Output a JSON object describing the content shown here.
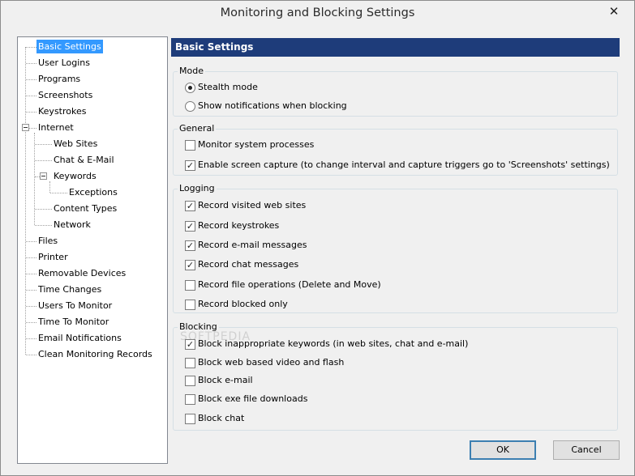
{
  "window": {
    "title": "Monitoring and Blocking Settings",
    "close_glyph": "✕"
  },
  "tree": {
    "items": [
      {
        "label": "Basic Settings"
      },
      {
        "label": "User Logins"
      },
      {
        "label": "Programs"
      },
      {
        "label": "Screenshots"
      },
      {
        "label": "Keystrokes"
      },
      {
        "label": "Internet"
      },
      {
        "label": "Web Sites"
      },
      {
        "label": "Chat & E-Mail"
      },
      {
        "label": "Keywords"
      },
      {
        "label": "Exceptions"
      },
      {
        "label": "Content Types"
      },
      {
        "label": "Network"
      },
      {
        "label": "Files"
      },
      {
        "label": "Printer"
      },
      {
        "label": "Removable Devices"
      },
      {
        "label": "Time Changes"
      },
      {
        "label": "Users To Monitor"
      },
      {
        "label": "Time To Monitor"
      },
      {
        "label": "Email Notifications"
      },
      {
        "label": "Clean Monitoring Records"
      }
    ]
  },
  "panel": {
    "header": "Basic Settings"
  },
  "mode": {
    "title": "Mode",
    "options": [
      {
        "label": "Stealth mode",
        "selected": true
      },
      {
        "label": "Show notifications when blocking",
        "selected": false
      }
    ]
  },
  "general": {
    "title": "General",
    "options": [
      {
        "label": "Monitor system processes",
        "checked": false
      },
      {
        "label": "Enable screen capture (to change  interval and capture triggers go to 'Screenshots' settings)",
        "checked": true
      }
    ]
  },
  "logging": {
    "title": "Logging",
    "options": [
      {
        "label": "Record visited web sites",
        "checked": true
      },
      {
        "label": "Record keystrokes",
        "checked": true
      },
      {
        "label": "Record e-mail messages",
        "checked": true
      },
      {
        "label": "Record chat messages",
        "checked": true
      },
      {
        "label": "Record file operations (Delete and Move)",
        "checked": false
      },
      {
        "label": "Record blocked only",
        "checked": false
      }
    ]
  },
  "blocking": {
    "title": "Blocking",
    "options": [
      {
        "label": "Block inappropriate keywords (in web sites, chat and e-mail)",
        "checked": true
      },
      {
        "label": "Block web based video and flash",
        "checked": false
      },
      {
        "label": "Block e-mail",
        "checked": false
      },
      {
        "label": "Block exe file downloads",
        "checked": false
      },
      {
        "label": "Block chat",
        "checked": false
      }
    ]
  },
  "buttons": {
    "ok": "OK",
    "cancel": "Cancel"
  },
  "watermark": "SOFTPEDIA"
}
